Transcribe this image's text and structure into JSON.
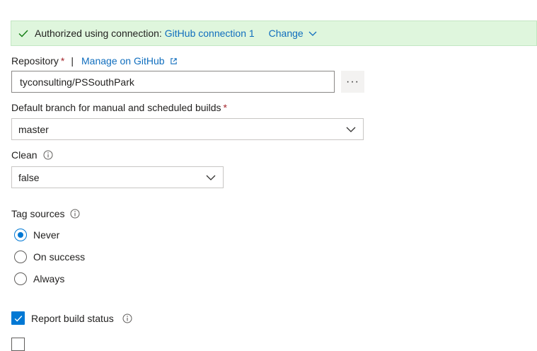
{
  "banner": {
    "authorized_text": "Authorized using connection:",
    "connection_name": "GitHub connection 1",
    "change_label": "Change"
  },
  "repository": {
    "label": "Repository",
    "required_mark": "*",
    "separator": "|",
    "manage_link": "Manage on GitHub",
    "value": "tyconsulting/PSSouthPark",
    "more_button": "···"
  },
  "default_branch": {
    "label": "Default branch for manual and scheduled builds",
    "required_mark": "*",
    "value": "master"
  },
  "clean": {
    "label": "Clean",
    "value": "false"
  },
  "tag_sources": {
    "label": "Tag sources",
    "options": [
      "Never",
      "On success",
      "Always"
    ],
    "selected": "Never"
  },
  "report_build_status": {
    "label": "Report build status",
    "checked": true
  },
  "colors": {
    "accent": "#0078d4",
    "link": "#106ebe",
    "banner_bg": "#dff6dd",
    "success_green": "#107c10",
    "required_red": "#a4262c"
  }
}
